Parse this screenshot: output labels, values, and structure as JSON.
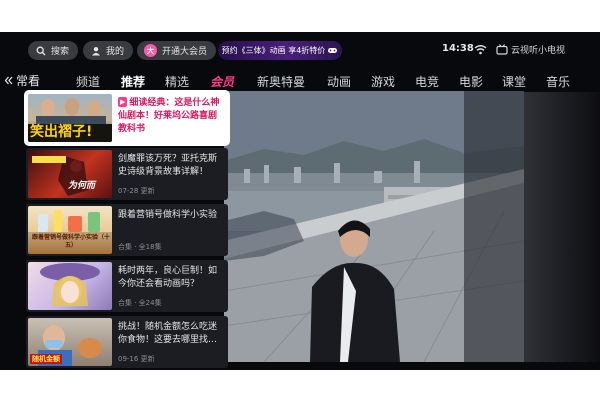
{
  "topbar": {
    "search_label": "搜索",
    "mine_label": "我的",
    "vip_label": "开通大会员",
    "promo_text": "预约《三体》动画 享4折特价",
    "clock": "14:38",
    "brand": "云视听小电视"
  },
  "nav": {
    "back_label": "常看",
    "tabs": [
      {
        "label": "频道"
      },
      {
        "label": "推荐"
      },
      {
        "label": "精选"
      },
      {
        "label": "会员"
      },
      {
        "label": "新奥特曼"
      },
      {
        "label": "动画"
      },
      {
        "label": "游戏"
      },
      {
        "label": "电竞"
      },
      {
        "label": "电影"
      },
      {
        "label": "课堂"
      },
      {
        "label": "音乐"
      }
    ],
    "active_tab": "推荐"
  },
  "list": {
    "items": [
      {
        "title": "细读经典：这是什么神仙剧本！好莱坞公路喜剧教科书",
        "sub": "",
        "thumb_caption": "笑出褶子!"
      },
      {
        "title": "剑魔罪该万死？亚托克斯史诗级背景故事详解！",
        "sub": "07-28 更新",
        "thumb_caption": "为何而"
      },
      {
        "title": "跟着营销号做科学小实验",
        "sub": "合集 · 全18集",
        "thumb_caption": "跟着营销号做科学小实验（十五）"
      },
      {
        "title": "耗时两年，良心巨制！如今你还会看动画吗？",
        "sub": "合集 · 全24集",
        "thumb_caption": ""
      },
      {
        "title": "挑战！随机金额怎么吃迷你食物！这要去哪里找…",
        "sub": "09-16 更新",
        "thumb_caption": "随机金额"
      }
    ]
  },
  "colors": {
    "accent": "#ff3b8a",
    "focused_title": "#d8185f",
    "background": "#08090c"
  }
}
